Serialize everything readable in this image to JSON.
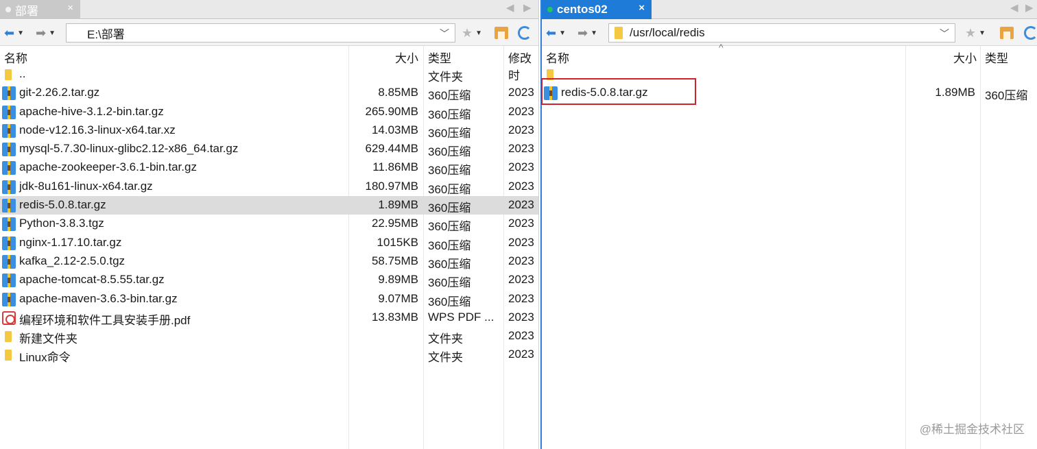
{
  "left": {
    "tab_title": "部署",
    "tab_close": "×",
    "nav_prev": "◀",
    "nav_next": "▶",
    "path": "E:\\部署",
    "columns": {
      "name": "名称",
      "size": "大小",
      "type": "类型",
      "modified": "修改时"
    },
    "rows": [
      {
        "icon": "folder-icon",
        "name": "..",
        "size": "",
        "type": "文件夹",
        "modified": ""
      },
      {
        "icon": "archive-icon",
        "name": "git-2.26.2.tar.gz",
        "size": "8.85MB",
        "type": "360压缩",
        "modified": "2023"
      },
      {
        "icon": "archive-icon",
        "name": "apache-hive-3.1.2-bin.tar.gz",
        "size": "265.90MB",
        "type": "360压缩",
        "modified": "2023"
      },
      {
        "icon": "archive-icon",
        "name": "node-v12.16.3-linux-x64.tar.xz",
        "size": "14.03MB",
        "type": "360压缩",
        "modified": "2023"
      },
      {
        "icon": "archive-icon",
        "name": "mysql-5.7.30-linux-glibc2.12-x86_64.tar.gz",
        "size": "629.44MB",
        "type": "360压缩",
        "modified": "2023"
      },
      {
        "icon": "archive-icon",
        "name": "apache-zookeeper-3.6.1-bin.tar.gz",
        "size": "11.86MB",
        "type": "360压缩",
        "modified": "2023"
      },
      {
        "icon": "archive-icon",
        "name": "jdk-8u161-linux-x64.tar.gz",
        "size": "180.97MB",
        "type": "360压缩",
        "modified": "2023"
      },
      {
        "icon": "archive-icon",
        "name": "redis-5.0.8.tar.gz",
        "size": "1.89MB",
        "type": "360压缩",
        "modified": "2023",
        "selected": true
      },
      {
        "icon": "archive-icon",
        "name": "Python-3.8.3.tgz",
        "size": "22.95MB",
        "type": "360压缩",
        "modified": "2023"
      },
      {
        "icon": "archive-icon",
        "name": "nginx-1.17.10.tar.gz",
        "size": "1015KB",
        "type": "360压缩",
        "modified": "2023"
      },
      {
        "icon": "archive-icon",
        "name": "kafka_2.12-2.5.0.tgz",
        "size": "58.75MB",
        "type": "360压缩",
        "modified": "2023"
      },
      {
        "icon": "archive-icon",
        "name": "apache-tomcat-8.5.55.tar.gz",
        "size": "9.89MB",
        "type": "360压缩",
        "modified": "2023"
      },
      {
        "icon": "archive-icon",
        "name": "apache-maven-3.6.3-bin.tar.gz",
        "size": "9.07MB",
        "type": "360压缩",
        "modified": "2023"
      },
      {
        "icon": "pdf-icon",
        "name": "编程环境和软件工具安装手册.pdf",
        "size": "13.83MB",
        "type": "WPS PDF ...",
        "modified": "2023"
      },
      {
        "icon": "folder-icon",
        "name": "新建文件夹",
        "size": "",
        "type": "文件夹",
        "modified": "2023"
      },
      {
        "icon": "folder-icon",
        "name": "Linux命令",
        "size": "",
        "type": "文件夹",
        "modified": "2023"
      }
    ]
  },
  "right": {
    "tab_title": "centos02",
    "tab_close": "×",
    "nav_prev": "◀",
    "nav_next": "▶",
    "path": "/usr/local/redis",
    "sort_indicator": "^",
    "columns": {
      "name": "名称",
      "size": "大小",
      "type": "类型"
    },
    "rows": [
      {
        "icon": "folder-icon",
        "name": "",
        "size": "",
        "type": ""
      },
      {
        "icon": "archive-icon",
        "name": "redis-5.0.8.tar.gz",
        "size": "1.89MB",
        "type": "360压缩"
      }
    ]
  },
  "colors": {
    "accent": "#1e7bd8",
    "highlight": "#d0202a",
    "selected_row": "#dcdcdc"
  },
  "watermark": "@稀土掘金技术社区"
}
